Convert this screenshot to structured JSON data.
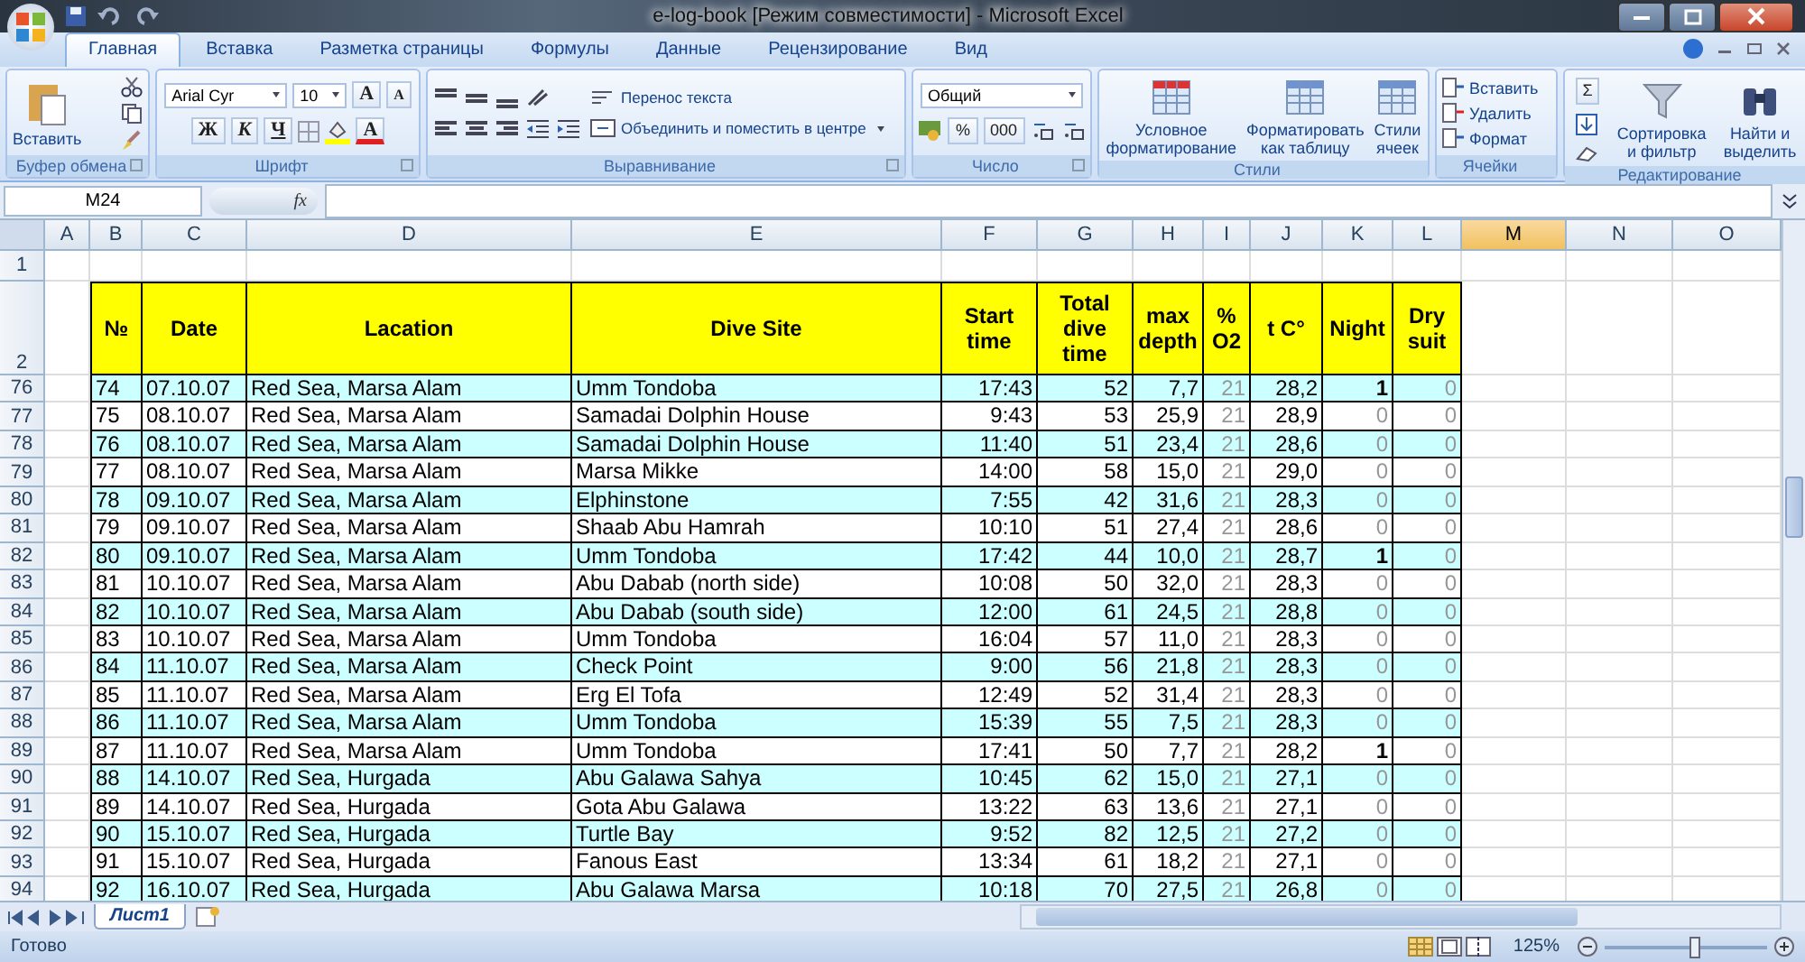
{
  "window": {
    "title": "e-log-book  [Режим совместимости] - Microsoft Excel"
  },
  "tabs": [
    {
      "label": "Главная",
      "selected": true
    },
    {
      "label": "Вставка",
      "selected": false
    },
    {
      "label": "Разметка страницы",
      "selected": false
    },
    {
      "label": "Формулы",
      "selected": false
    },
    {
      "label": "Данные",
      "selected": false
    },
    {
      "label": "Рецензирование",
      "selected": false
    },
    {
      "label": "Вид",
      "selected": false
    }
  ],
  "ribbon": {
    "clipboard": {
      "paste": "Вставить",
      "label": "Буфер обмена"
    },
    "font": {
      "family": "Arial Cyr",
      "size": "10",
      "grow": "A",
      "shrink": "A",
      "bold": "Ж",
      "italic": "К",
      "underline": "Ч",
      "color_letter": "A",
      "label": "Шрифт"
    },
    "alignment": {
      "wrap": "Перенос текста",
      "merge": "Объединить и поместить в центре",
      "label": "Выравнивание"
    },
    "number": {
      "format": "Общий",
      "percent": "%",
      "thousands": "000",
      "label": "Число"
    },
    "styles": {
      "buttons": [
        "Условное\nформатирование",
        "Форматировать\nкак таблицу",
        "Стили\nячеек"
      ],
      "label": "Стили"
    },
    "cells": {
      "buttons": [
        "Вставить",
        "Удалить",
        "Формат"
      ],
      "label": "Ячейки"
    },
    "editing": {
      "sum": "Σ",
      "buttons": [
        "Сортировка\nи фильтр",
        "Найти и\nвыделить"
      ],
      "label": "Редактирование"
    }
  },
  "formula_bar": {
    "name_box": "M24",
    "fx": "fx"
  },
  "sheet": {
    "columns": [
      {
        "label": "A",
        "selected": false
      },
      {
        "label": "B",
        "selected": false
      },
      {
        "label": "C",
        "selected": false
      },
      {
        "label": "D",
        "selected": false
      },
      {
        "label": "E",
        "selected": false
      },
      {
        "label": "F",
        "selected": false
      },
      {
        "label": "G",
        "selected": false
      },
      {
        "label": "H",
        "selected": false
      },
      {
        "label": "I",
        "selected": false
      },
      {
        "label": "J",
        "selected": false
      },
      {
        "label": "K",
        "selected": false
      },
      {
        "label": "L",
        "selected": false
      },
      {
        "label": "M",
        "selected": true
      },
      {
        "label": "N",
        "selected": false
      },
      {
        "label": "O",
        "selected": false
      }
    ],
    "blank_row": "1",
    "header_row": {
      "n": "2",
      "cells": [
        "",
        "№",
        "Date",
        "Lacation",
        "Dive Site",
        "Start\ntime",
        "Total\ndive\ntime",
        "max\ndepth",
        "%\nO2",
        "t C°",
        "Night",
        "Dry\nsuit"
      ]
    },
    "rows": [
      {
        "n": "76",
        "shaded": true,
        "night": true,
        "cells": [
          "",
          "74",
          "07.10.07",
          "Red Sea, Marsa Alam",
          "Umm Tondoba",
          "17:43",
          "52",
          "7,7",
          "21",
          "28,2",
          "1",
          "0"
        ]
      },
      {
        "n": "77",
        "shaded": false,
        "night": false,
        "cells": [
          "",
          "75",
          "08.10.07",
          "Red Sea, Marsa Alam",
          "Samadai Dolphin House",
          "9:43",
          "53",
          "25,9",
          "21",
          "28,9",
          "0",
          "0"
        ]
      },
      {
        "n": "78",
        "shaded": true,
        "night": false,
        "cells": [
          "",
          "76",
          "08.10.07",
          "Red Sea, Marsa Alam",
          "Samadai Dolphin House",
          "11:40",
          "51",
          "23,4",
          "21",
          "28,6",
          "0",
          "0"
        ]
      },
      {
        "n": "79",
        "shaded": false,
        "night": false,
        "cells": [
          "",
          "77",
          "08.10.07",
          "Red Sea, Marsa Alam",
          "Marsa Mikke",
          "14:00",
          "58",
          "15,0",
          "21",
          "29,0",
          "0",
          "0"
        ]
      },
      {
        "n": "80",
        "shaded": true,
        "night": false,
        "cells": [
          "",
          "78",
          "09.10.07",
          "Red Sea, Marsa Alam",
          "Elphinstone",
          "7:55",
          "42",
          "31,6",
          "21",
          "28,3",
          "0",
          "0"
        ]
      },
      {
        "n": "81",
        "shaded": false,
        "night": false,
        "cells": [
          "",
          "79",
          "09.10.07",
          "Red Sea, Marsa Alam",
          "Shaab Abu Hamrah",
          "10:10",
          "51",
          "27,4",
          "21",
          "28,6",
          "0",
          "0"
        ]
      },
      {
        "n": "82",
        "shaded": true,
        "night": true,
        "cells": [
          "",
          "80",
          "09.10.07",
          "Red Sea, Marsa Alam",
          "Umm Tondoba",
          "17:42",
          "44",
          "10,0",
          "21",
          "28,7",
          "1",
          "0"
        ]
      },
      {
        "n": "83",
        "shaded": false,
        "night": false,
        "cells": [
          "",
          "81",
          "10.10.07",
          "Red Sea, Marsa Alam",
          "Abu Dabab (north side)",
          "10:08",
          "50",
          "32,0",
          "21",
          "28,3",
          "0",
          "0"
        ]
      },
      {
        "n": "84",
        "shaded": true,
        "night": false,
        "cells": [
          "",
          "82",
          "10.10.07",
          "Red Sea, Marsa Alam",
          "Abu Dabab (south side)",
          "12:00",
          "61",
          "24,5",
          "21",
          "28,8",
          "0",
          "0"
        ]
      },
      {
        "n": "85",
        "shaded": false,
        "night": false,
        "cells": [
          "",
          "83",
          "10.10.07",
          "Red Sea, Marsa Alam",
          "Umm Tondoba",
          "16:04",
          "57",
          "11,0",
          "21",
          "28,3",
          "0",
          "0"
        ]
      },
      {
        "n": "86",
        "shaded": true,
        "night": false,
        "cells": [
          "",
          "84",
          "11.10.07",
          "Red Sea, Marsa Alam",
          "Check Point",
          "9:00",
          "56",
          "21,8",
          "21",
          "28,3",
          "0",
          "0"
        ]
      },
      {
        "n": "87",
        "shaded": false,
        "night": false,
        "cells": [
          "",
          "85",
          "11.10.07",
          "Red Sea, Marsa Alam",
          "Erg El Tofa",
          "12:49",
          "52",
          "31,4",
          "21",
          "28,3",
          "0",
          "0"
        ]
      },
      {
        "n": "88",
        "shaded": true,
        "night": false,
        "cells": [
          "",
          "86",
          "11.10.07",
          "Red Sea, Marsa Alam",
          "Umm Tondoba",
          "15:39",
          "55",
          "7,5",
          "21",
          "28,3",
          "0",
          "0"
        ]
      },
      {
        "n": "89",
        "shaded": false,
        "night": true,
        "cells": [
          "",
          "87",
          "11.10.07",
          "Red Sea, Marsa Alam",
          "Umm Tondoba",
          "17:41",
          "50",
          "7,7",
          "21",
          "28,2",
          "1",
          "0"
        ]
      },
      {
        "n": "90",
        "shaded": true,
        "night": false,
        "cells": [
          "",
          "88",
          "14.10.07",
          "Red Sea, Hurgada",
          "Abu Galawa Sahya",
          "10:45",
          "62",
          "15,0",
          "21",
          "27,1",
          "0",
          "0"
        ]
      },
      {
        "n": "91",
        "shaded": false,
        "night": false,
        "cells": [
          "",
          "89",
          "14.10.07",
          "Red Sea, Hurgada",
          "Gota Abu Galawa",
          "13:22",
          "63",
          "13,6",
          "21",
          "27,1",
          "0",
          "0"
        ]
      },
      {
        "n": "92",
        "shaded": true,
        "night": false,
        "cells": [
          "",
          "90",
          "15.10.07",
          "Red Sea, Hurgada",
          "Turtle Bay",
          "9:52",
          "82",
          "12,5",
          "21",
          "27,2",
          "0",
          "0"
        ]
      },
      {
        "n": "93",
        "shaded": false,
        "night": false,
        "cells": [
          "",
          "91",
          "15.10.07",
          "Red Sea, Hurgada",
          "Fanous East",
          "13:34",
          "61",
          "18,2",
          "21",
          "27,1",
          "0",
          "0"
        ]
      },
      {
        "n": "94",
        "shaded": true,
        "night": false,
        "cells": [
          "",
          "92",
          "16.10.07",
          "Red Sea, Hurgada",
          "Abu Galawa Marsa",
          "10:18",
          "70",
          "27,5",
          "21",
          "26,8",
          "0",
          "0"
        ]
      }
    ]
  },
  "sheet_tabs": [
    {
      "label": "Лист1",
      "selected": true
    }
  ],
  "status_bar": {
    "text": "Готово",
    "zoom": "125%",
    "level": 0.55
  }
}
